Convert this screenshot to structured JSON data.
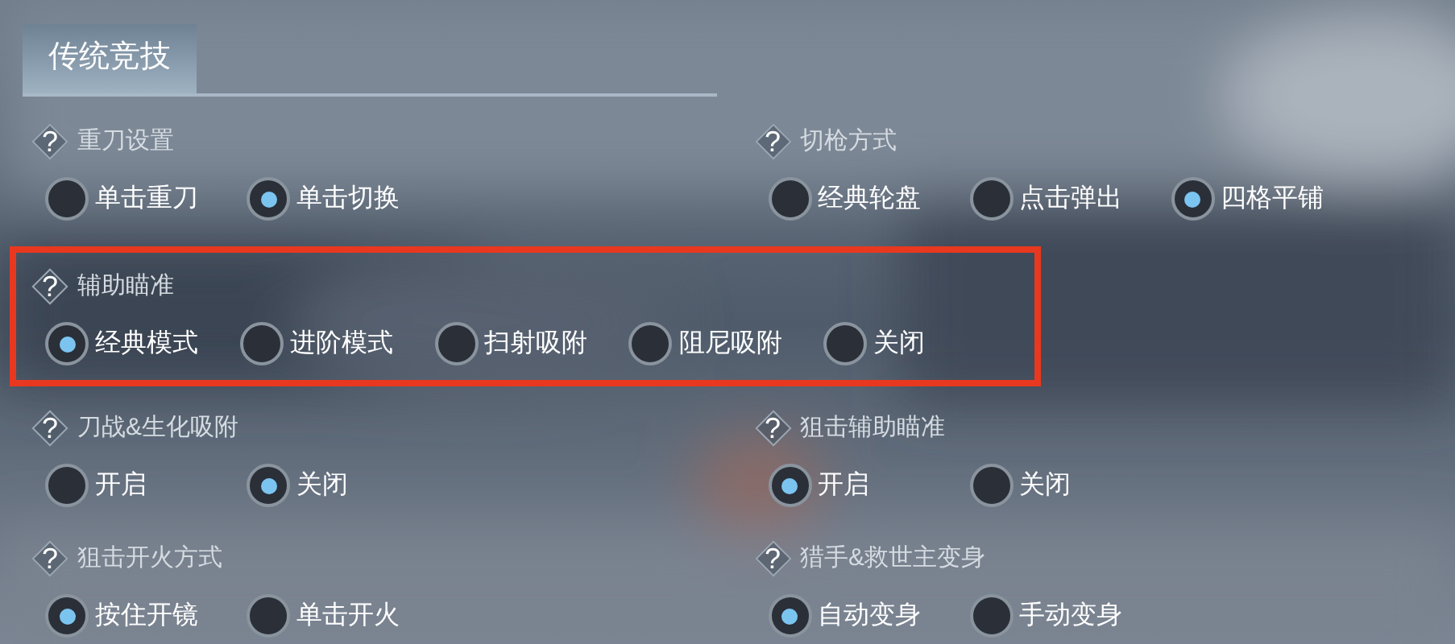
{
  "tabs": [
    {
      "label": "传统竞技",
      "selected": true
    }
  ],
  "rows": [
    [
      {
        "help": "?",
        "title": "重刀设置",
        "options": [
          {
            "label": "单击重刀",
            "selected": false
          },
          {
            "label": "单击切换",
            "selected": true
          }
        ]
      },
      {
        "help": "?",
        "title": "切枪方式",
        "options": [
          {
            "label": "经典轮盘",
            "selected": false
          },
          {
            "label": "点击弹出",
            "selected": false
          },
          {
            "label": "四格平铺",
            "selected": true
          }
        ]
      }
    ],
    [
      {
        "help": "?",
        "title": "辅助瞄准",
        "highlighted": true,
        "options": [
          {
            "label": "经典模式",
            "selected": true
          },
          {
            "label": "进阶模式",
            "selected": false
          },
          {
            "label": "扫射吸附",
            "selected": false
          },
          {
            "label": "阻尼吸附",
            "selected": false
          },
          {
            "label": "关闭",
            "selected": false
          }
        ]
      }
    ],
    [
      {
        "help": "?",
        "title": "刀战&生化吸附",
        "options": [
          {
            "label": "开启",
            "selected": false
          },
          {
            "label": "关闭",
            "selected": true
          }
        ]
      },
      {
        "help": "?",
        "title": "狙击辅助瞄准",
        "options": [
          {
            "label": "开启",
            "selected": true
          },
          {
            "label": "关闭",
            "selected": false
          }
        ]
      }
    ],
    [
      {
        "help": "?",
        "title": "狙击开火方式",
        "options": [
          {
            "label": "按住开镜",
            "selected": true
          },
          {
            "label": "单击开火",
            "selected": false
          }
        ]
      },
      {
        "help": "?",
        "title": "猎手&救世主变身",
        "options": [
          {
            "label": "自动变身",
            "selected": true
          },
          {
            "label": "手动变身",
            "selected": false
          }
        ]
      }
    ]
  ]
}
